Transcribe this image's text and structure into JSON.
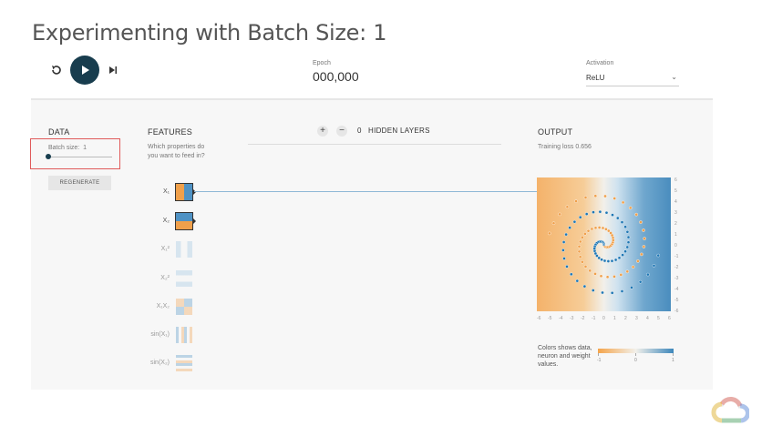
{
  "title": "Experimenting with Batch Size: 1",
  "controls": {
    "reset_icon": "reset-icon",
    "play_icon": "play-icon",
    "step_icon": "step-forward-icon"
  },
  "epoch": {
    "label": "Epoch",
    "value": "000,000"
  },
  "activation": {
    "label": "Activation",
    "value": "ReLU"
  },
  "data_section": {
    "header": "DATA",
    "batch_label": "Batch size:",
    "batch_value": "1",
    "batch_slider_level": 0,
    "regenerate": "REGENERATE"
  },
  "features_section": {
    "header": "FEATURES",
    "subtitle": "Which properties do you want to feed in?",
    "features": [
      {
        "label": "X₁",
        "active": true
      },
      {
        "label": "X₂",
        "active": true
      },
      {
        "label": "X₁²",
        "active": false
      },
      {
        "label": "X₂²",
        "active": false
      },
      {
        "label": "X₁X₂",
        "active": false
      },
      {
        "label": "sin(X₁)",
        "active": false
      },
      {
        "label": "sin(X₂)",
        "active": false
      }
    ]
  },
  "hidden_layers": {
    "plus": "+",
    "minus": "−",
    "count": "0",
    "label": "HIDDEN LAYERS"
  },
  "output_section": {
    "header": "OUTPUT",
    "training_loss": "Training loss 0.656",
    "y_ticks": [
      "6",
      "5",
      "4",
      "3",
      "2",
      "1",
      "0",
      "-1",
      "-2",
      "-3",
      "-4",
      "-5",
      "-6"
    ],
    "x_ticks": [
      "-6",
      "-5",
      "-4",
      "-3",
      "-2",
      "-1",
      "0",
      "1",
      "2",
      "3",
      "4",
      "5",
      "6"
    ],
    "legend_text": "Colors shows data, neuron and weight values.",
    "legend_ticks": [
      "-1",
      "0",
      "1"
    ]
  },
  "colors": {
    "orange": "#f0a04b",
    "blue": "#1f77b4",
    "accent_dark": "#183d4e",
    "highlight_red": "#e05a5a"
  }
}
